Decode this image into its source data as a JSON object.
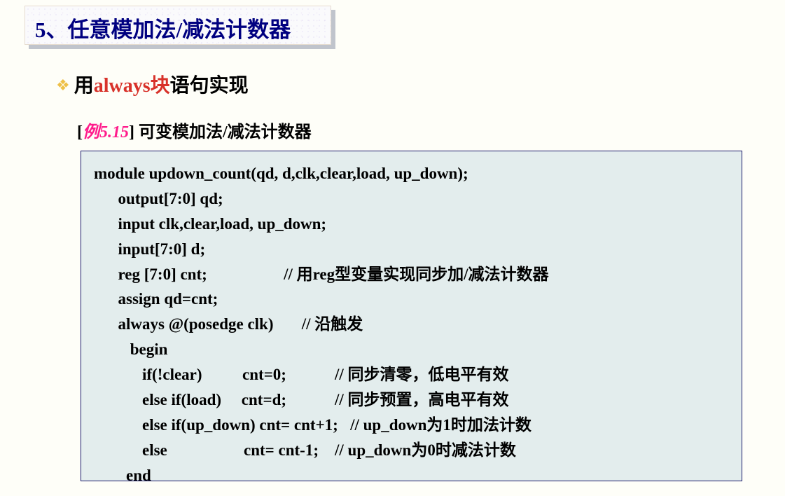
{
  "title": "5、任意模加法/减法计数器",
  "subtitle": {
    "prefix": "用",
    "red": "always块",
    "suffix": "语句实现"
  },
  "example": {
    "bracket_open": "[",
    "label": "例5.15",
    "bracket_close": "]",
    "desc": " 可变模加法/减法计数器"
  },
  "code": {
    "l1": "module updown_count(qd, d,clk,clear,load, up_down);",
    "l2": "      output[7:0] qd;",
    "l3": "      input clk,clear,load, up_down;",
    "l4": "      input[7:0] d;",
    "l5a": "      reg [7:0] cnt;",
    "l5c": "                   // 用reg型变量实现同步加/减法计数器",
    "l6": "      assign qd=cnt;",
    "l7a": "      always @(posedge clk)",
    "l7c": "       // 沿触发",
    "l8": "         begin",
    "l9a": "            if(!clear)          cnt=0;",
    "l9c": "            // 同步清零，低电平有效",
    "l10a": "            else if(load)     cnt=d;",
    "l10c": "            // 同步预置，高电平有效",
    "l11a": "            else if(up_down) cnt= cnt+1;",
    "l11c": "   // up_down为1时加法计数",
    "l12a": "            else                   cnt= cnt-1;",
    "l12c": "    // up_down为0时减法计数",
    "l13": "        end"
  }
}
